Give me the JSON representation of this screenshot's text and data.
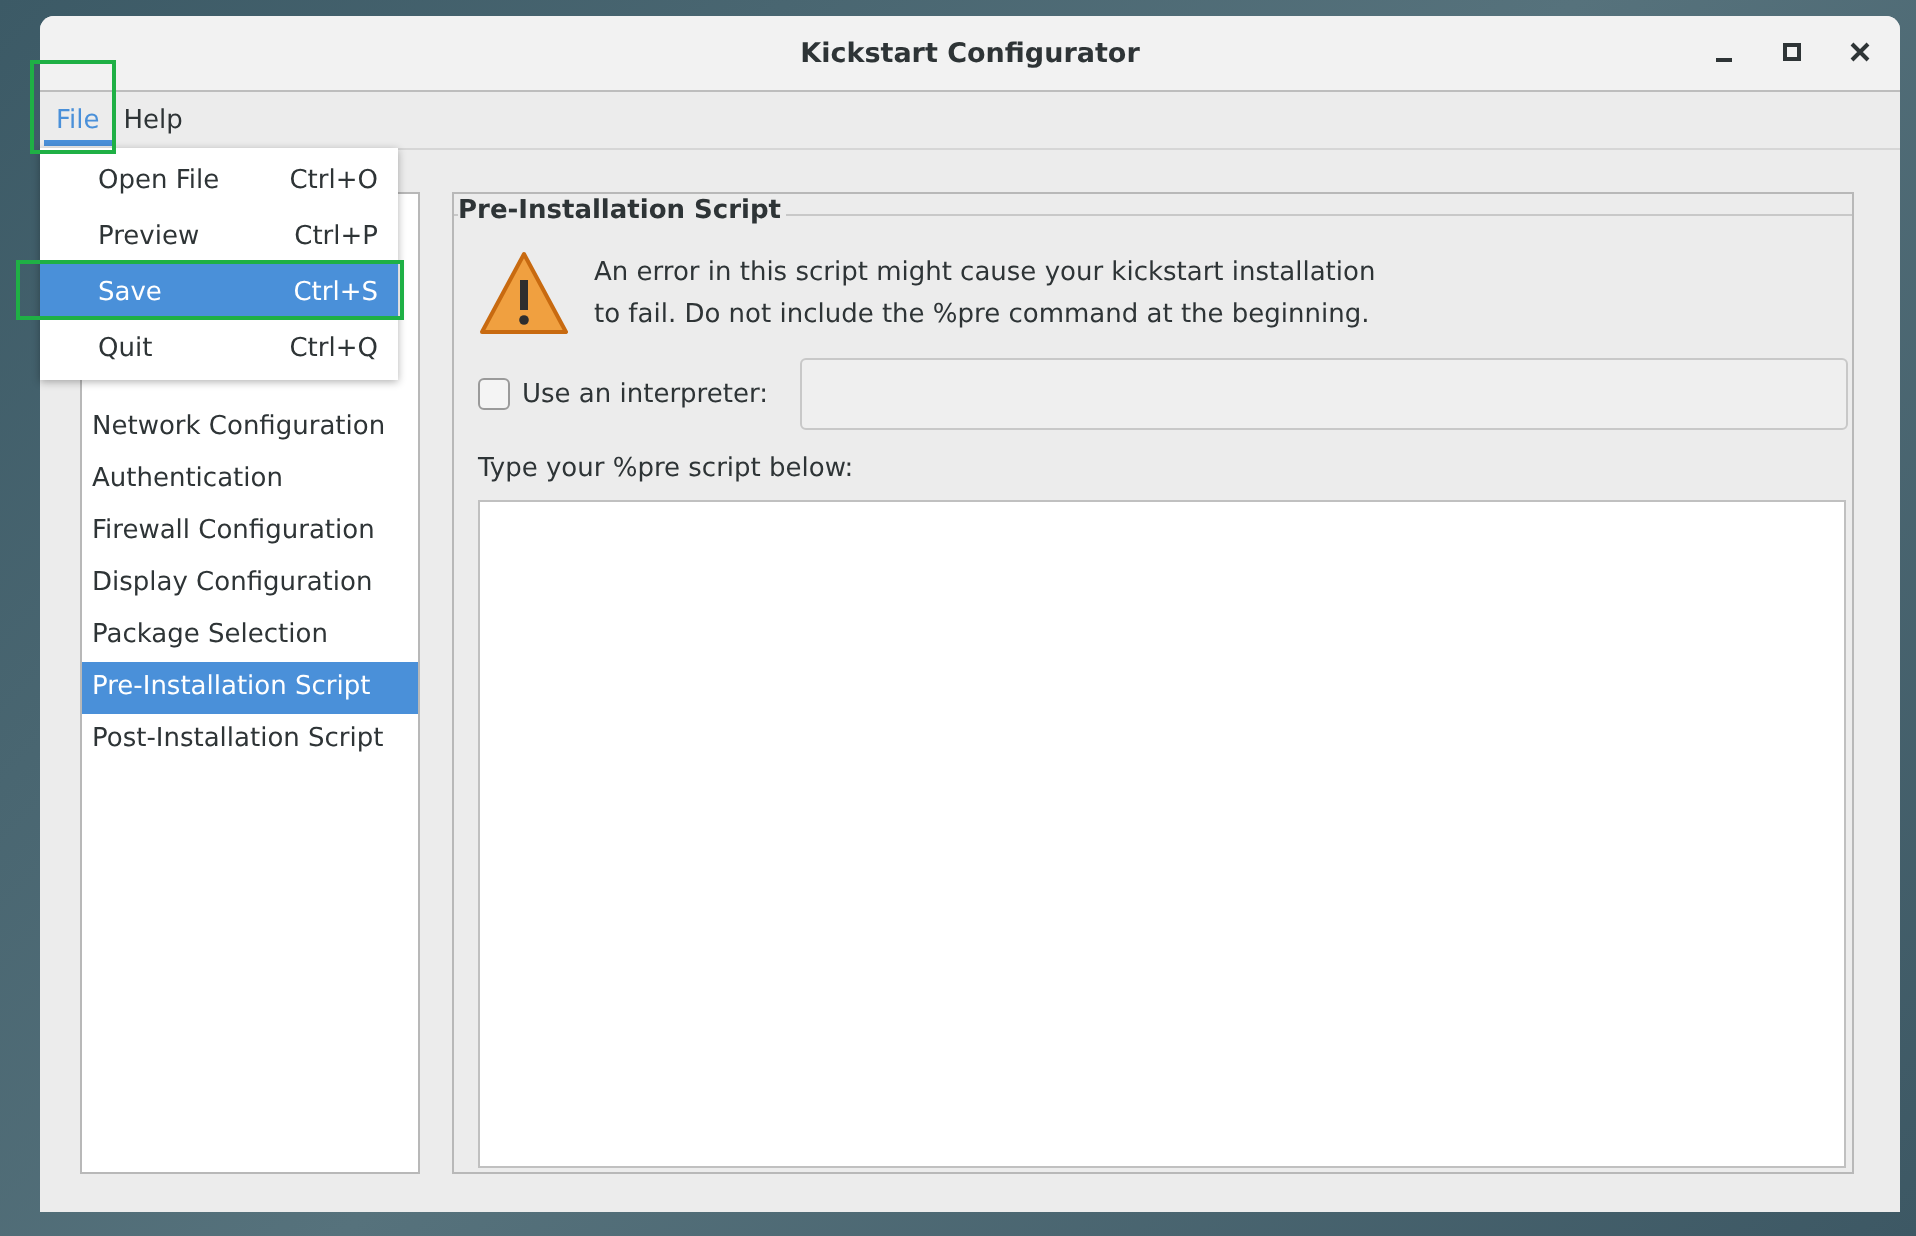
{
  "window": {
    "title": "Kickstart Configurator"
  },
  "menubar": [
    {
      "label": "File",
      "selected": true
    },
    {
      "label": "Help",
      "selected": false
    }
  ],
  "file_menu": [
    {
      "label": "Open File",
      "shortcut": "Ctrl+O",
      "selected": false
    },
    {
      "label": "Preview",
      "shortcut": "Ctrl+P",
      "selected": false
    },
    {
      "label": "Save",
      "shortcut": "Ctrl+S",
      "selected": true
    },
    {
      "label": "Quit",
      "shortcut": "Ctrl+Q",
      "selected": false
    }
  ],
  "sidebar": {
    "items": [
      {
        "label": "Network Configuration",
        "selected": false
      },
      {
        "label": "Authentication",
        "selected": false
      },
      {
        "label": "Firewall Configuration",
        "selected": false
      },
      {
        "label": "Display Configuration",
        "selected": false
      },
      {
        "label": "Package Selection",
        "selected": false
      },
      {
        "label": "Pre-Installation Script",
        "selected": true
      },
      {
        "label": "Post-Installation Script",
        "selected": false
      }
    ]
  },
  "panel": {
    "title": "Pre-Installation Script",
    "warning": "An error in this script might cause your kickstart installation to fail. Do not include the %pre command at the beginning.",
    "interpreter": {
      "label": "Use an interpreter:",
      "checked": false
    },
    "script_label": "Type your %pre script below:"
  }
}
